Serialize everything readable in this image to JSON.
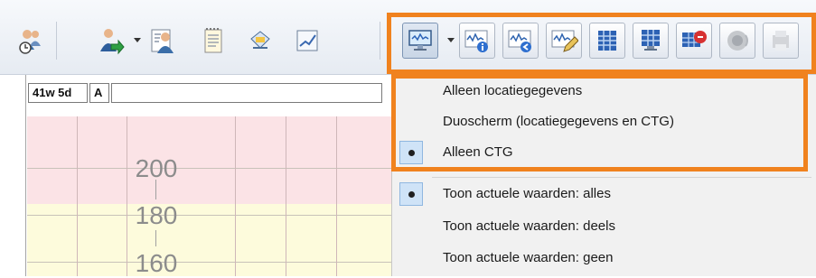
{
  "toolbar": {
    "buttons": [
      {
        "name": "patient-clock-icon"
      },
      {
        "name": "patient-transfer-icon"
      },
      {
        "name": "patient-card-icon"
      },
      {
        "name": "notes-icon"
      },
      {
        "name": "printer-icon"
      },
      {
        "name": "chart-icon"
      },
      {
        "name": "monitor-view-icon"
      },
      {
        "name": "ctg-info-icon"
      },
      {
        "name": "ctg-back-icon"
      },
      {
        "name": "ctg-edit-icon"
      },
      {
        "name": "grid-table-icon"
      },
      {
        "name": "monitor-grid-icon"
      },
      {
        "name": "monitor-mute-icon"
      },
      {
        "name": "sound-icon"
      },
      {
        "name": "print-disabled-icon"
      }
    ]
  },
  "infobar": {
    "gestation": "41w 5d",
    "flag": "A"
  },
  "chart": {
    "y_labels": [
      "200",
      "180",
      "160"
    ],
    "colors": {
      "pink": "#fbe3e6",
      "yellow": "#fdfbdc"
    }
  },
  "menu": {
    "items": [
      {
        "label": "Alleen locatiegegevens",
        "checked": false
      },
      {
        "label": "Duoscherm (locatiegegevens en CTG)",
        "checked": false
      },
      {
        "label": "Alleen CTG",
        "checked": true
      },
      {
        "label": "Toon actuele waarden: alles",
        "checked": true
      },
      {
        "label": "Toon actuele waarden: deels",
        "checked": false
      },
      {
        "label": "Toon actuele waarden: geen",
        "checked": false
      }
    ]
  },
  "highlight_color": "#f0821e"
}
